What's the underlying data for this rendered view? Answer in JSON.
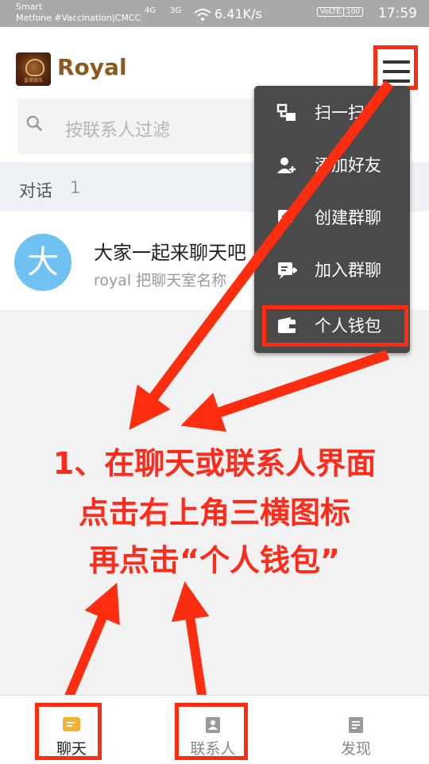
{
  "status_bar": {
    "carrier_line1": "Smart",
    "carrier_line2": "Metfone #Vaccination|CMCC",
    "sig1": "4G",
    "sig2": "3G",
    "speed": "6.41K/s",
    "volte": "VoLTE",
    "battery": "100",
    "time": "17:59"
  },
  "header": {
    "brand": "Royal",
    "logo_text": "皇家娱乐"
  },
  "search": {
    "placeholder": "按联系人过滤"
  },
  "section": {
    "label": "对话",
    "count": "1"
  },
  "conversation": {
    "avatar_char": "大",
    "title": "大家一起来聊天吧",
    "subtitle": "royal 把聊天室名称"
  },
  "menu": {
    "items": [
      {
        "label": "扫一扫",
        "icon": "scan-icon"
      },
      {
        "label": "添加好友",
        "icon": "add-friend-icon"
      },
      {
        "label": "创建群聊",
        "icon": "create-group-icon"
      },
      {
        "label": "加入群聊",
        "icon": "join-group-icon"
      },
      {
        "label": "个人钱包",
        "icon": "wallet-icon"
      }
    ]
  },
  "annotation": {
    "line1": "1、在聊天或联系人界面",
    "line2": "点击右上角三横图标",
    "line3": "再点击“个人钱包”"
  },
  "bottom_nav": {
    "tabs": [
      {
        "label": "聊天",
        "icon": "chat-icon",
        "color": "#f2b233"
      },
      {
        "label": "联系人",
        "icon": "contacts-icon",
        "color": "#9a9a9a"
      },
      {
        "label": "发现",
        "icon": "discover-icon",
        "color": "#9a9a9a"
      }
    ]
  },
  "colors": {
    "brand": "#8a5a1f",
    "annotation_red": "#ff2a1a",
    "menu_bg": "#4a4a4a",
    "avatar": "#6ec1f0"
  }
}
